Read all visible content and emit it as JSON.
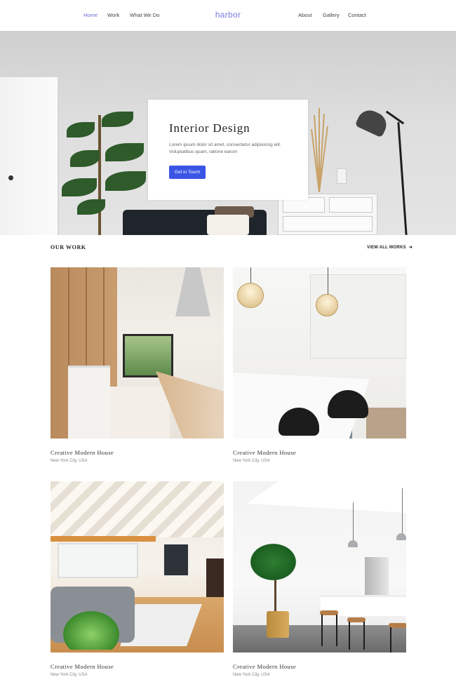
{
  "nav": {
    "left_links": [
      "Home",
      "Work",
      "What We Do"
    ],
    "brand": "harbor",
    "right_links": [
      "About",
      "Gallery",
      "Contact"
    ],
    "active": "Home"
  },
  "hero": {
    "title": "Interior Design",
    "description": "Lorem ipsum dolor sit amet, consectetur adipisicing elit. Voluptatibus quam, ratione earum",
    "cta_label": "Get in Touch"
  },
  "work": {
    "section_title": "OUR WORK",
    "view_all_label": "VIEW ALL WORKS",
    "view_all_icon": "arrow-right-icon",
    "projects": [
      {
        "title": "Creative Modern House",
        "location": "New York City, USA"
      },
      {
        "title": "Creative Modern House",
        "location": "New York City, USA"
      },
      {
        "title": "Creative Modern House",
        "location": "New York City, USA"
      },
      {
        "title": "Creative Modern House",
        "location": "New York City, USA"
      }
    ]
  },
  "colors": {
    "accent": "#6b6bd6",
    "button": "#3b55e6"
  }
}
